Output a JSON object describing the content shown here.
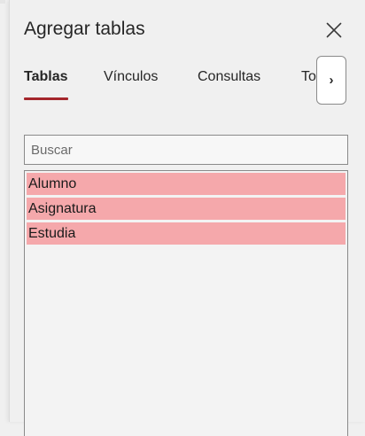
{
  "pane": {
    "title": "Agregar tablas"
  },
  "tabs": [
    {
      "label": "Tablas",
      "active": true
    },
    {
      "label": "Vínculos",
      "active": false
    },
    {
      "label": "Consultas",
      "active": false
    },
    {
      "label": "Todas",
      "active": false
    }
  ],
  "tab_scroll": {
    "glyph": "›"
  },
  "search": {
    "placeholder": "Buscar",
    "value": ""
  },
  "tables": [
    {
      "name": "Alumno"
    },
    {
      "name": "Asignatura"
    },
    {
      "name": "Estudia"
    }
  ],
  "colors": {
    "active_tab_underline": "#a4262c",
    "selected_item": "#f5a8ab"
  }
}
